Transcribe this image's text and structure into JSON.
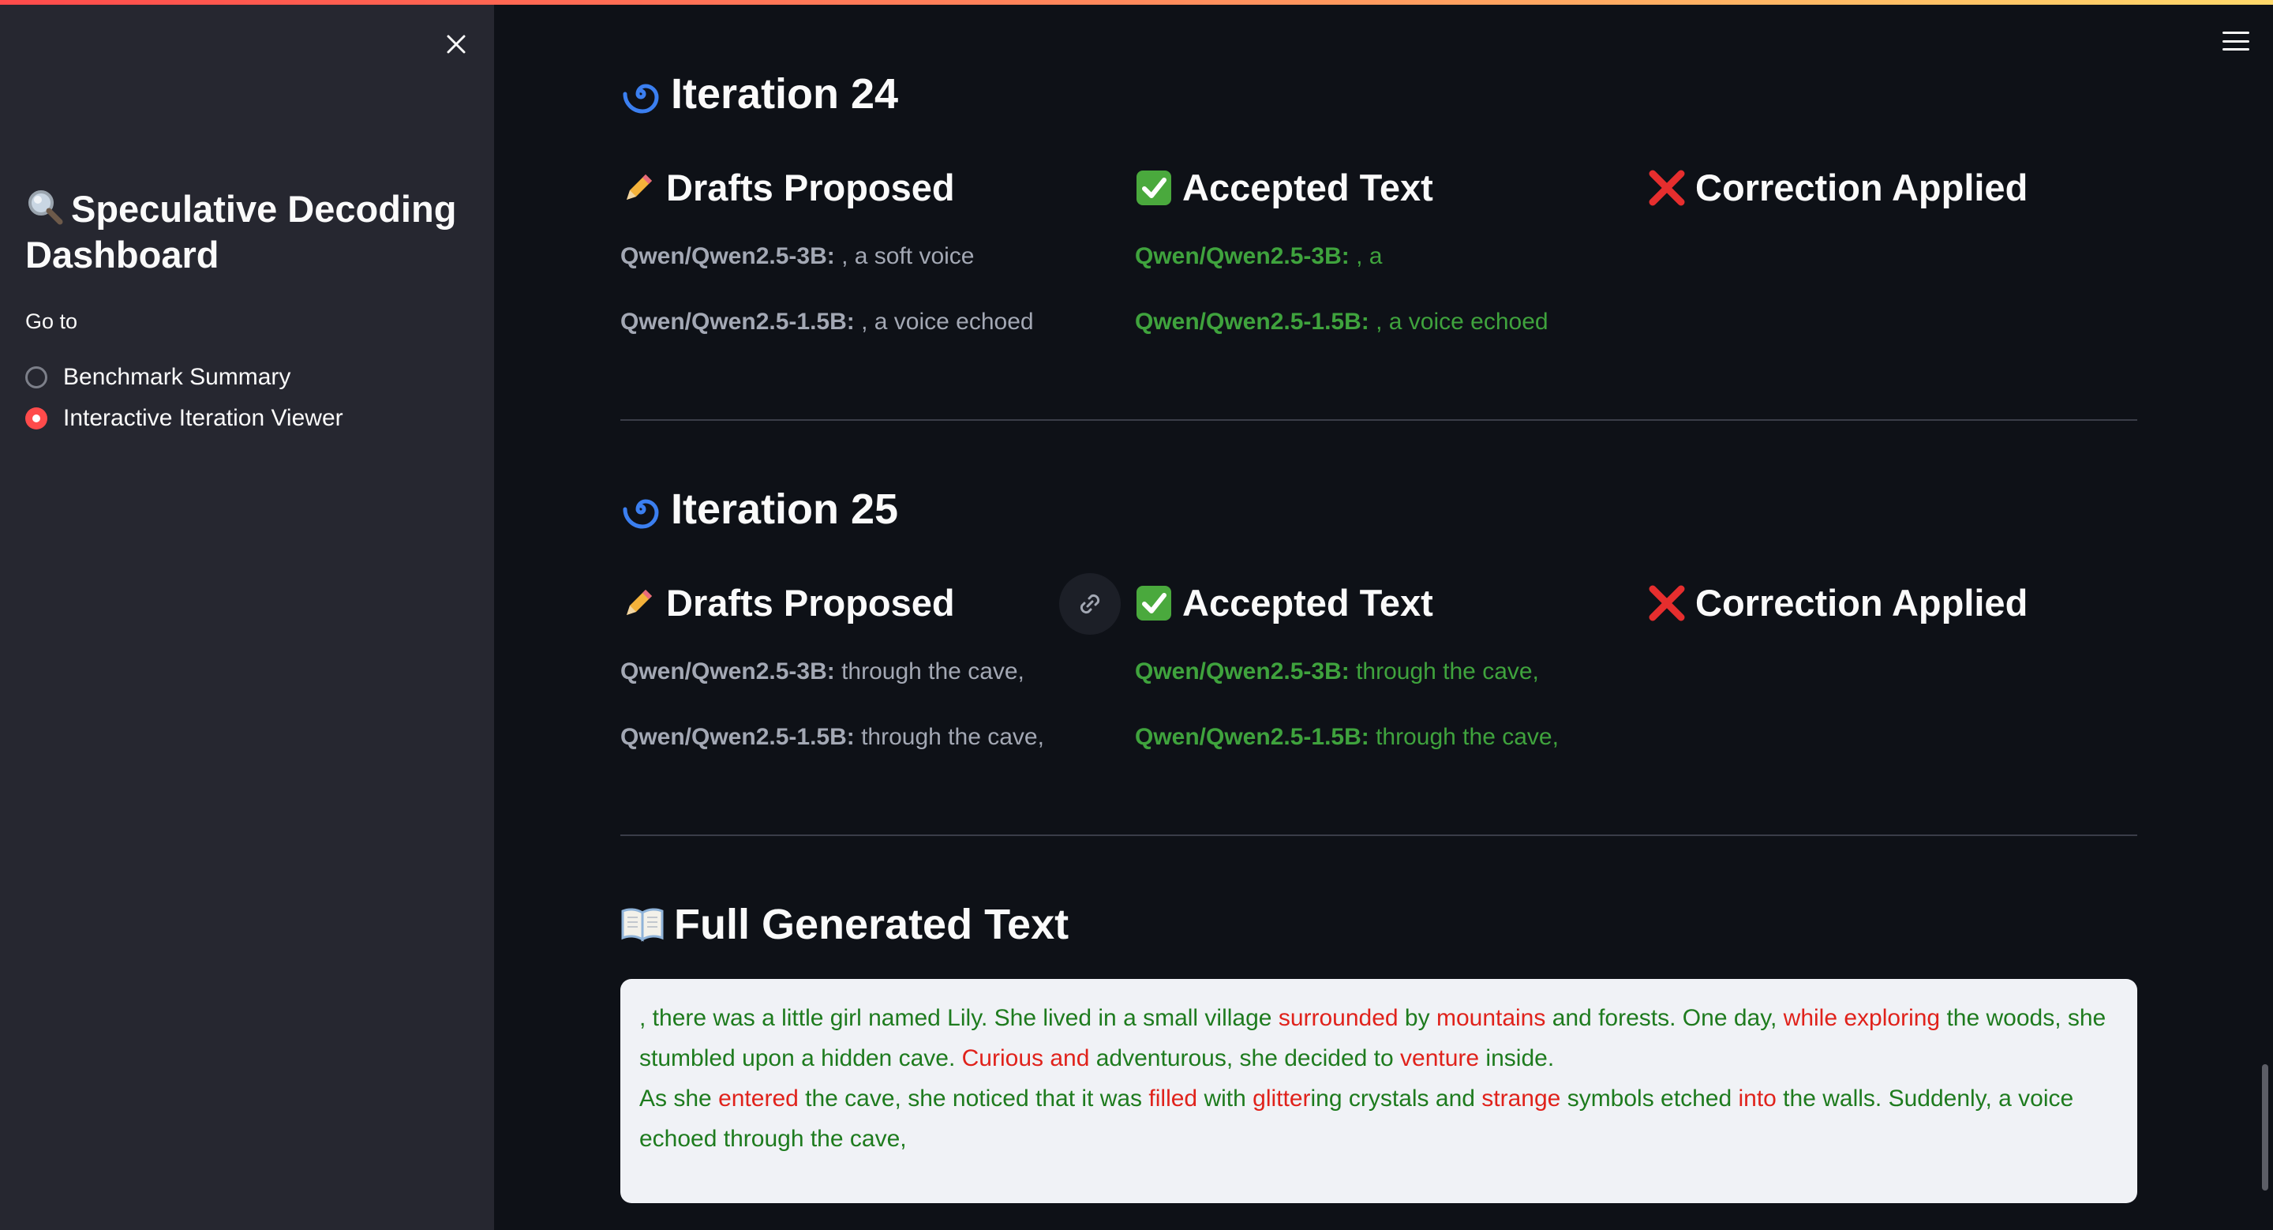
{
  "sidebar": {
    "title": "Speculative Decoding Dashboard",
    "title_icon": "magnifier-icon",
    "goto_label": "Go to",
    "options": [
      {
        "label": "Benchmark Summary",
        "selected": false
      },
      {
        "label": "Interactive Iteration Viewer",
        "selected": true
      }
    ]
  },
  "colors": {
    "accent": "#ff4b4b",
    "accepted": "#3fa33d",
    "rejected": "#e0221b",
    "background": "#0e1117",
    "sidebar": "#262730"
  },
  "iterations": [
    {
      "title": "Iteration 24",
      "icon": "cyclone-icon",
      "drafts_header": "Drafts Proposed",
      "accepted_header": "Accepted Text",
      "correction_header": "Correction Applied",
      "drafts": [
        {
          "model": "Qwen/Qwen2.5-3B:",
          "text": " , a soft voice"
        },
        {
          "model": "Qwen/Qwen2.5-1.5B:",
          "text": " , a voice echoed"
        }
      ],
      "accepted": [
        {
          "model": "Qwen/Qwen2.5-3B:",
          "text": " , a"
        },
        {
          "model": "Qwen/Qwen2.5-1.5B:",
          "text": " , a voice echoed"
        }
      ]
    },
    {
      "title": "Iteration 25",
      "icon": "cyclone-icon",
      "drafts_header": "Drafts Proposed",
      "accepted_header": "Accepted Text",
      "correction_header": "Correction Applied",
      "drafts": [
        {
          "model": "Qwen/Qwen2.5-3B:",
          "text": " through the cave,"
        },
        {
          "model": "Qwen/Qwen2.5-1.5B:",
          "text": " through the cave,"
        }
      ],
      "accepted": [
        {
          "model": "Qwen/Qwen2.5-3B:",
          "text": " through the cave,"
        },
        {
          "model": "Qwen/Qwen2.5-1.5B:",
          "text": " through the cave,"
        }
      ]
    }
  ],
  "full_text": {
    "title": "Full Generated Text",
    "icon": "open-book-icon",
    "paragraphs": [
      [
        {
          "t": ", there was a little girl named Lily. She lived in a small village ",
          "c": "g"
        },
        {
          "t": "surrounded",
          "c": "r"
        },
        {
          "t": " by ",
          "c": "g"
        },
        {
          "t": "mountains",
          "c": "r"
        },
        {
          "t": " and forests. One day, ",
          "c": "g"
        },
        {
          "t": "while exploring",
          "c": "r"
        },
        {
          "t": " the woods, she stumbled upon a hidden cave. ",
          "c": "g"
        },
        {
          "t": "Curious",
          "c": "r"
        },
        {
          "t": " ",
          "c": "g"
        },
        {
          "t": "and",
          "c": "r"
        },
        {
          "t": " adventurous, she decided to ",
          "c": "g"
        },
        {
          "t": "venture",
          "c": "r"
        },
        {
          "t": " inside.",
          "c": "g"
        }
      ],
      [
        {
          "t": "As she ",
          "c": "g"
        },
        {
          "t": "entered",
          "c": "r"
        },
        {
          "t": " the cave, she noticed that it was ",
          "c": "g"
        },
        {
          "t": "filled",
          "c": "r"
        },
        {
          "t": " with ",
          "c": "g"
        },
        {
          "t": "glitter",
          "c": "r"
        },
        {
          "t": "ing crystals and ",
          "c": "g"
        },
        {
          "t": "strange",
          "c": "r"
        },
        {
          "t": " symbols etched ",
          "c": "g"
        },
        {
          "t": "into",
          "c": "r"
        },
        {
          "t": " the walls. Suddenly, a voice echoed through the cave,",
          "c": "g"
        }
      ]
    ]
  }
}
